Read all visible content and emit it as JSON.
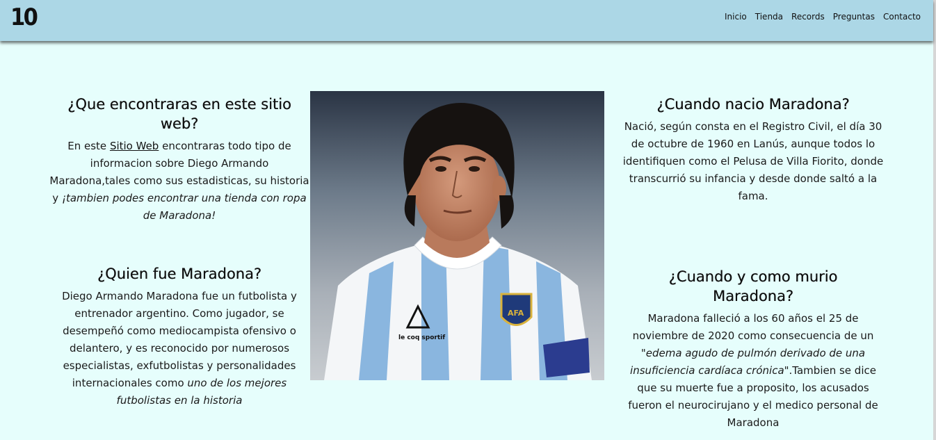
{
  "header": {
    "logo": "10",
    "nav": [
      "Inicio",
      "Tienda",
      "Records",
      "Preguntas",
      "Contacto"
    ]
  },
  "sections": {
    "que": {
      "title": "¿Que encontraras en este sitio web?",
      "text_a": "En este ",
      "link": "Sitio Web",
      "text_b": " encontraras todo tipo de informacion sobre Diego Armando Maradona,tales como sus estadisticas, su historia y ",
      "italic": "¡tambien podes encontrar una tienda con ropa de Maradona!"
    },
    "quien": {
      "title": "¿Quien fue Maradona?",
      "text": "Diego Armando Maradona fue un futbolista y entrenador argentino. Como jugador, se desempeñó como mediocampista ofensivo o delantero, y es reconocido por numerosos especialistas, exfutbolistas y personalidades internacionales como ",
      "italic": "uno de los mejores futbolistas en la historia"
    },
    "nacio": {
      "title": "¿Cuando nacio Maradona?",
      "text": "Nació, según consta en el Registro Civil, el día 30 de octubre de 1960 en Lanús, aunque todos lo identifiquen como el Pelusa de Villa Fiorito, donde transcurrió su infancia y desde donde saltó a la fama."
    },
    "murio": {
      "title": "¿Cuando y como murio Maradona?",
      "text_a": "Maradona falleció a los 60 años el 25 de noviembre de 2020 como consecuencia de un \"",
      "italic": "edema agudo de pulmón derivado de una insuficiencia cardíaca crónica",
      "text_b": "\".Tambien se dice que su muerte fue a proposito, los acusados fueron el neurocirujano y el medico personal de Maradona"
    }
  },
  "photo": {
    "shirt_brand": "le coq sportif",
    "badge": "AFA"
  }
}
